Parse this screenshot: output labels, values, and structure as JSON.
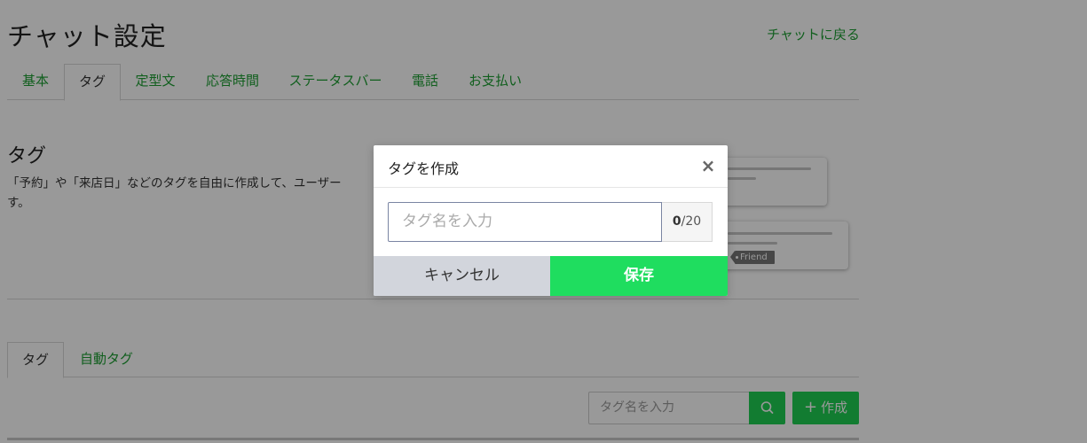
{
  "page": {
    "title": "チャット設定",
    "back_link": "チャットに戻る"
  },
  "tabs": [
    {
      "label": "基本"
    },
    {
      "label": "タグ"
    },
    {
      "label": "定型文"
    },
    {
      "label": "応答時間"
    },
    {
      "label": "ステータスバー"
    },
    {
      "label": "電話"
    },
    {
      "label": "お支払い"
    }
  ],
  "active_tab": "タグ",
  "section": {
    "title": "タグ",
    "description_line1": "「予約」や「来店日」などのタグを自由に作成して、ユーザー",
    "description_line2": "す。"
  },
  "illustration": {
    "friend_tag": "Friend"
  },
  "subtabs": [
    {
      "label": "タグ"
    },
    {
      "label": "自動タグ"
    }
  ],
  "active_subtab": "タグ",
  "toolbar": {
    "search_placeholder": "タグ名を入力",
    "create_label": "作成",
    "create_icon": "+"
  },
  "modal": {
    "title": "タグを作成",
    "close_icon": "×",
    "input_placeholder": "タグ名を入力",
    "input_value": "",
    "counter_current": "0",
    "counter_max": "/20",
    "cancel_label": "キャンセル",
    "save_label": "保存"
  },
  "colors": {
    "accent_green": "#1d9e32",
    "button_green": "#1fcf53",
    "save_green": "#1fdd5f",
    "cancel_gray": "#d2d5dc",
    "overlay": "rgba(0,0,0,0.4)"
  }
}
